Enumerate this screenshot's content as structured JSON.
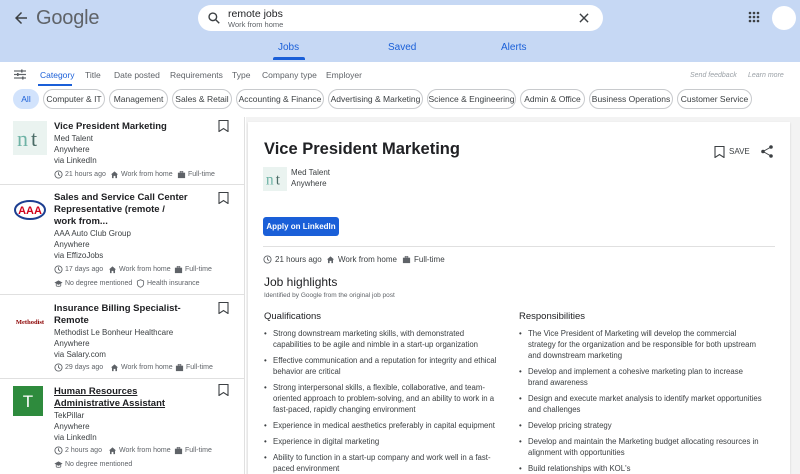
{
  "header": {
    "logo": "Google",
    "search": {
      "query": "remote jobs",
      "subtitle": "Work from home"
    },
    "tabs": [
      "Jobs",
      "Saved",
      "Alerts"
    ]
  },
  "filters": {
    "items": [
      "Category",
      "Title",
      "Date posted",
      "Requirements",
      "Type",
      "Company type",
      "Employer"
    ],
    "send_feedback": "Send feedback",
    "learn_more": "Learn more"
  },
  "chips": [
    "All",
    "Computer & IT",
    "Management",
    "Sales & Retail",
    "Accounting & Finance",
    "Advertising & Marketing",
    "Science & Engineering",
    "Admin & Office",
    "Business Operations",
    "Customer Service"
  ],
  "jobs": [
    {
      "title": "Vice President Marketing",
      "company": "Med Talent",
      "location": "Anywhere",
      "via": "via LinkedIn",
      "posted": "21 hours ago",
      "remote": "Work from home",
      "type": "Full-time"
    },
    {
      "title_lines": [
        "Sales and Service Call Center",
        "Representative (remote /",
        "work from..."
      ],
      "company": "AAA Auto Club Group",
      "location": "Anywhere",
      "via": "via EffizoJobs",
      "posted": "17 days ago",
      "remote": "Work from home",
      "type": "Full-time",
      "degree": "No degree mentioned",
      "benefit": "Health insurance",
      "logo_text": "AAA"
    },
    {
      "title_lines": [
        "Insurance Billing Specialist-",
        "Remote"
      ],
      "company": "Methodist Le Bonheur Healthcare",
      "location": "Anywhere",
      "via": "via Salary.com",
      "posted": "29 days ago",
      "remote": "Work from home",
      "type": "Full-time",
      "logo_text": "Methodist"
    },
    {
      "title_lines": [
        "Human Resources",
        "Administrative Assistant"
      ],
      "company": "TekPillar",
      "location": "Anywhere",
      "via": "via LinkedIn",
      "posted": "2 hours ago",
      "remote": "Work from home",
      "type": "Full-time",
      "degree": "No degree mentioned",
      "logo_text": "T"
    }
  ],
  "detail": {
    "title": "Vice President Marketing",
    "save": "SAVE",
    "company": "Med Talent",
    "location": "Anywhere",
    "apply": "Apply on LinkedIn",
    "posted": "21 hours ago",
    "remote": "Work from home",
    "type": "Full-time",
    "highlights_title": "Job highlights",
    "highlights_note": "Identified by Google from the original job post",
    "qualifications_title": "Qualifications",
    "qualifications": [
      "Strong downstream marketing skills, with demonstrated capabilities to be agile and nimble in a start-up organization",
      "Effective communication and a reputation for integrity and ethical behavior are critical",
      "Strong interpersonal skills, a flexible, collaborative, and team-oriented approach to problem-solving, and an ability to work in a fast-paced, rapidly changing environment",
      "Experience in medical aesthetics preferably in capital equipment",
      "Experience in digital marketing",
      "Ability to function in a start-up company and work well in a fast-paced environment"
    ],
    "responsibilities_title": "Responsibilities",
    "responsibilities": [
      "The Vice President of Marketing will develop the commercial strategy for the organization and be responsible for both upstream and downstream marketing",
      "Develop and implement a cohesive marketing plan to increase brand awareness",
      "Design and execute market analysis to identify market opportunities and challenges",
      "Develop pricing strategy",
      "Develop and maintain the Marketing budget allocating resources in alignment with opportunities",
      "Build relationships with KOL's"
    ]
  },
  "colors": {
    "accent": "#1a5fd8",
    "header_bg": "#c6d8f4",
    "chip_active": "#d2e3fc",
    "tekpillar_green": "#2e8b3d"
  }
}
